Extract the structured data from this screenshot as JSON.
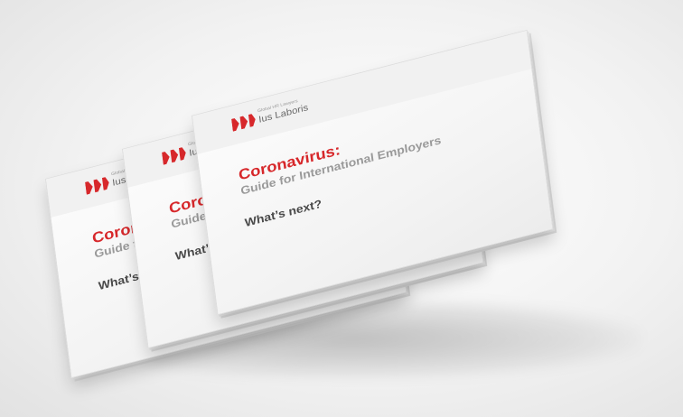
{
  "booklet": {
    "logo_small": "Global HR Lawyers",
    "logo_main": "Ius Laboris",
    "title": "Coronavirus:",
    "subtitle": "Guide for International Employers",
    "tagline": "What’s next?"
  },
  "colors": {
    "accent": "#d7282b",
    "subtitle_gray": "#9a9a9a",
    "tagline_dark": "#4a4a4a",
    "paper": "#f7f7f7"
  }
}
